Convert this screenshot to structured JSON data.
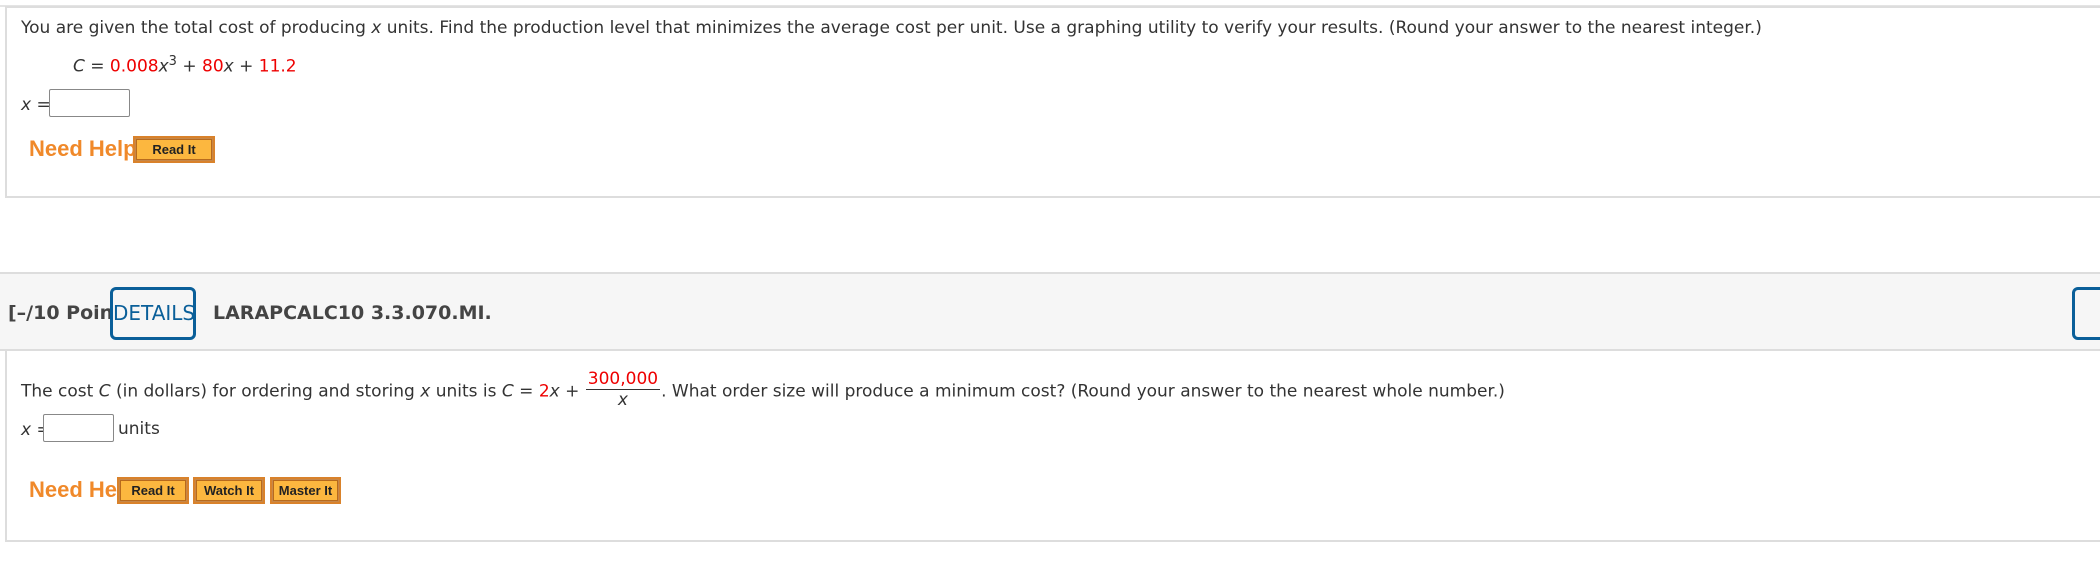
{
  "q1": {
    "prompt_pre": "You are given the total cost of producing ",
    "var": "x",
    "prompt_post": " units. Find the production level that minimizes the average cost per unit. Use a graphing utility to verify your results. (Round your answer to the nearest integer.)",
    "formula": {
      "lhs": "C = ",
      "c1": "0.008",
      "x1": "x",
      "exp": "3",
      "plus1": " + ",
      "c2": "80",
      "x2": "x",
      "plus2": " + ",
      "c3": "11.2"
    },
    "answer_label": "x =",
    "answer_value": "",
    "need_help": "Need Help?",
    "buttons": [
      "Read It"
    ]
  },
  "q2": {
    "points": "[–/10 Points]",
    "details": "DETAILS",
    "code": "LARAPCALC10 3.3.070.MI.",
    "prompt": {
      "t1": "The cost ",
      "C": "C",
      "t2": " (in dollars) for ordering and storing ",
      "x": "x",
      "t3": " units is ",
      "C2": "C",
      "eq": " = ",
      "coef": "2",
      "x2": "x",
      "plus": " + ",
      "num": "300,000",
      "den": "x",
      "t4": ". What order size will produce a minimum cost? (Round your answer to the nearest whole number.)"
    },
    "answer_label": "x =",
    "answer_value": "",
    "unit": "units",
    "need_help": "Need Help?",
    "buttons": [
      "Read It",
      "Watch It",
      "Master It"
    ]
  },
  "colors": {
    "accent": "#0a5f99",
    "help": "#f0892a",
    "value": "#e00000",
    "button": "#fcb73f"
  }
}
